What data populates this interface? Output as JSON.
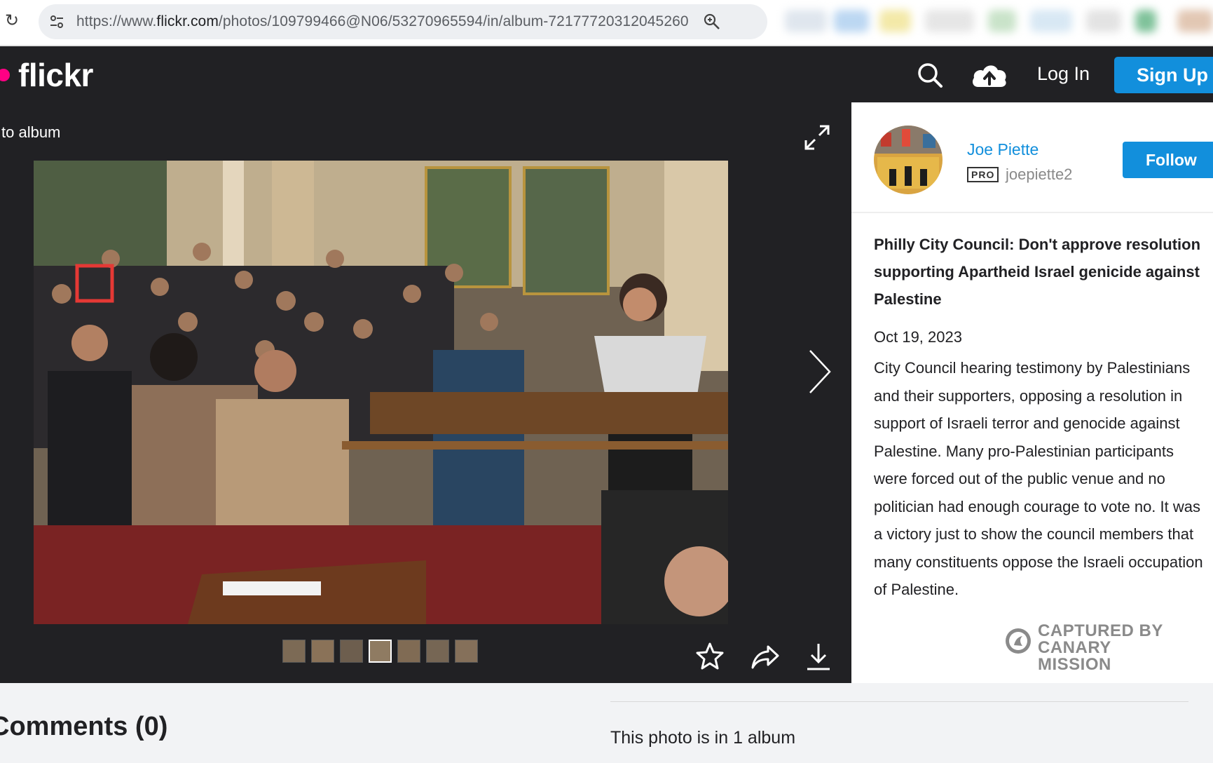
{
  "browser": {
    "url_prefix": "https://www.",
    "url_domain": "flickr.com",
    "url_path": "/photos/109799466@N06/53270965594/in/album-72177720312045260",
    "reload_icon": "reload-icon",
    "zoom_icon": "zoom-icon"
  },
  "header": {
    "logo": "flickr",
    "brand_pink": "#ff0084",
    "accent_blue": "#128fdc",
    "login_label": "Log In",
    "signup_label": "Sign Up"
  },
  "photo_view": {
    "back_label": "to album",
    "thumbnail_count": 7
  },
  "owner": {
    "name": "Joe Piette",
    "pro_badge": "PRO",
    "username": "joepiette2",
    "follow_label": "Follow"
  },
  "photo_info": {
    "title": "Philly City Council: Don't approve resolution supporting Apartheid Israel genicide against Palestine",
    "date": "Oct 19, 2023",
    "description": "City Council hearing testimony by Palestinians and their supporters, opposing a resolution in support of Israeli terror and genocide against Palestine. Many pro-Palestinian participants were forced out of the public venue and no politician had enough courage to vote no. It was a victory just to show the council members that many constituents oppose the Israeli occupation of Palestine."
  },
  "watermark": {
    "line1": "CAPTURED BY",
    "line2": "CANARY MISSION"
  },
  "comments": {
    "heading": "Comments (0)"
  },
  "albums": {
    "text": "This photo is in 1 album"
  }
}
